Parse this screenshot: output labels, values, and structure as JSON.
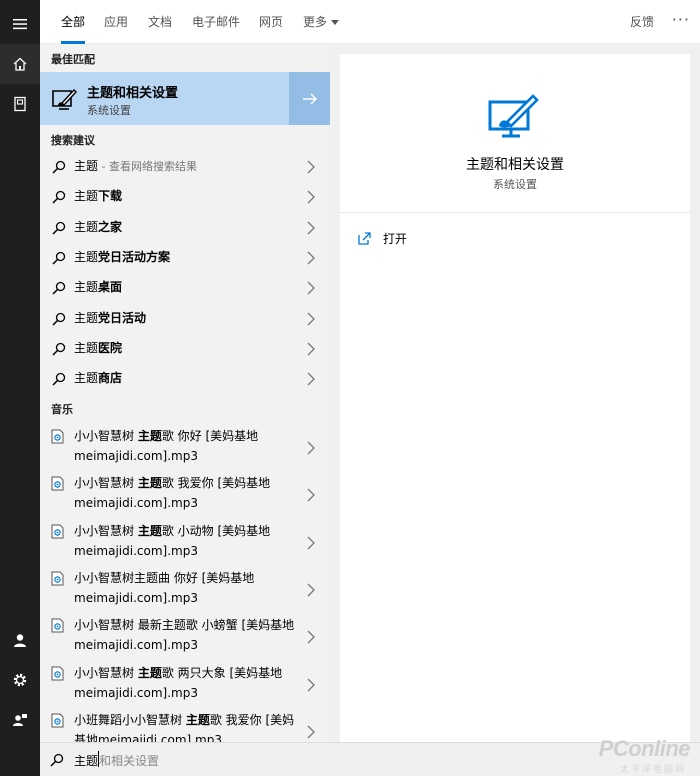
{
  "tabs": [
    {
      "label": "全部",
      "active": true
    },
    {
      "label": "应用"
    },
    {
      "label": "文档"
    },
    {
      "label": "电子邮件"
    },
    {
      "label": "网页"
    },
    {
      "label": "更多"
    }
  ],
  "header": {
    "feedback": "反馈",
    "more_options": "···"
  },
  "sections": {
    "best_match": "最佳匹配",
    "suggestions": "搜索建议",
    "music": "音乐"
  },
  "best_match": {
    "title": "主题和相关设置",
    "subtitle": "系统设置",
    "icon": "display-settings-icon",
    "arrow_icon": "arrow-right-icon"
  },
  "suggestions": [
    {
      "prefix": "主题",
      "bold": "",
      "suffix": " - 查看网络搜索结果"
    },
    {
      "prefix": "主题",
      "bold": "下载",
      "suffix": ""
    },
    {
      "prefix": "主题",
      "bold": "之家",
      "suffix": ""
    },
    {
      "prefix": "主题",
      "bold": "党日活动方案",
      "suffix": ""
    },
    {
      "prefix": "主题",
      "bold": "桌面",
      "suffix": ""
    },
    {
      "prefix": "主题",
      "bold": "党日活动",
      "suffix": ""
    },
    {
      "prefix": "主题",
      "bold": "医院",
      "suffix": ""
    },
    {
      "prefix": "主题",
      "bold": "商店",
      "suffix": ""
    }
  ],
  "music": [
    {
      "before": "小小智慧树 ",
      "bold": "主题",
      "after": "歌 你好 [美妈基地meimajidi.com].mp3"
    },
    {
      "before": "小小智慧树 ",
      "bold": "主题",
      "after": "歌 我爱你 [美妈基地meimajidi.com].mp3"
    },
    {
      "before": "小小智慧树 ",
      "bold": "主题",
      "after": "歌 小动物 [美妈基地meimajidi.com].mp3"
    },
    {
      "before": "小小智慧树主题曲 你好 [美妈基地meimajidi.com].mp3",
      "bold": "",
      "after": ""
    },
    {
      "before": "小小智慧树 最新主题歌 小螃蟹 [美妈基地meimajidi.com].mp3",
      "bold": "",
      "after": ""
    },
    {
      "before": "小小智慧树 ",
      "bold": "主题",
      "after": "歌 两只大象 [美妈基地meimajidi.com].mp3"
    },
    {
      "before": "小班舞蹈小小智慧树 ",
      "bold": "主题",
      "after": "歌 我爱你 [美妈基地meimajidi.com].mp3"
    }
  ],
  "preview": {
    "title": "主题和相关设置",
    "subtitle": "系统设置",
    "action": "打开"
  },
  "search": {
    "typed": "主题",
    "completion": "和相关设置"
  },
  "watermark": {
    "brand": "PConline",
    "sub": "太平洋电脑网"
  },
  "colors": {
    "accent": "#0078d7",
    "selection": "#b9d7f3",
    "rail": "#1f1f1f"
  }
}
